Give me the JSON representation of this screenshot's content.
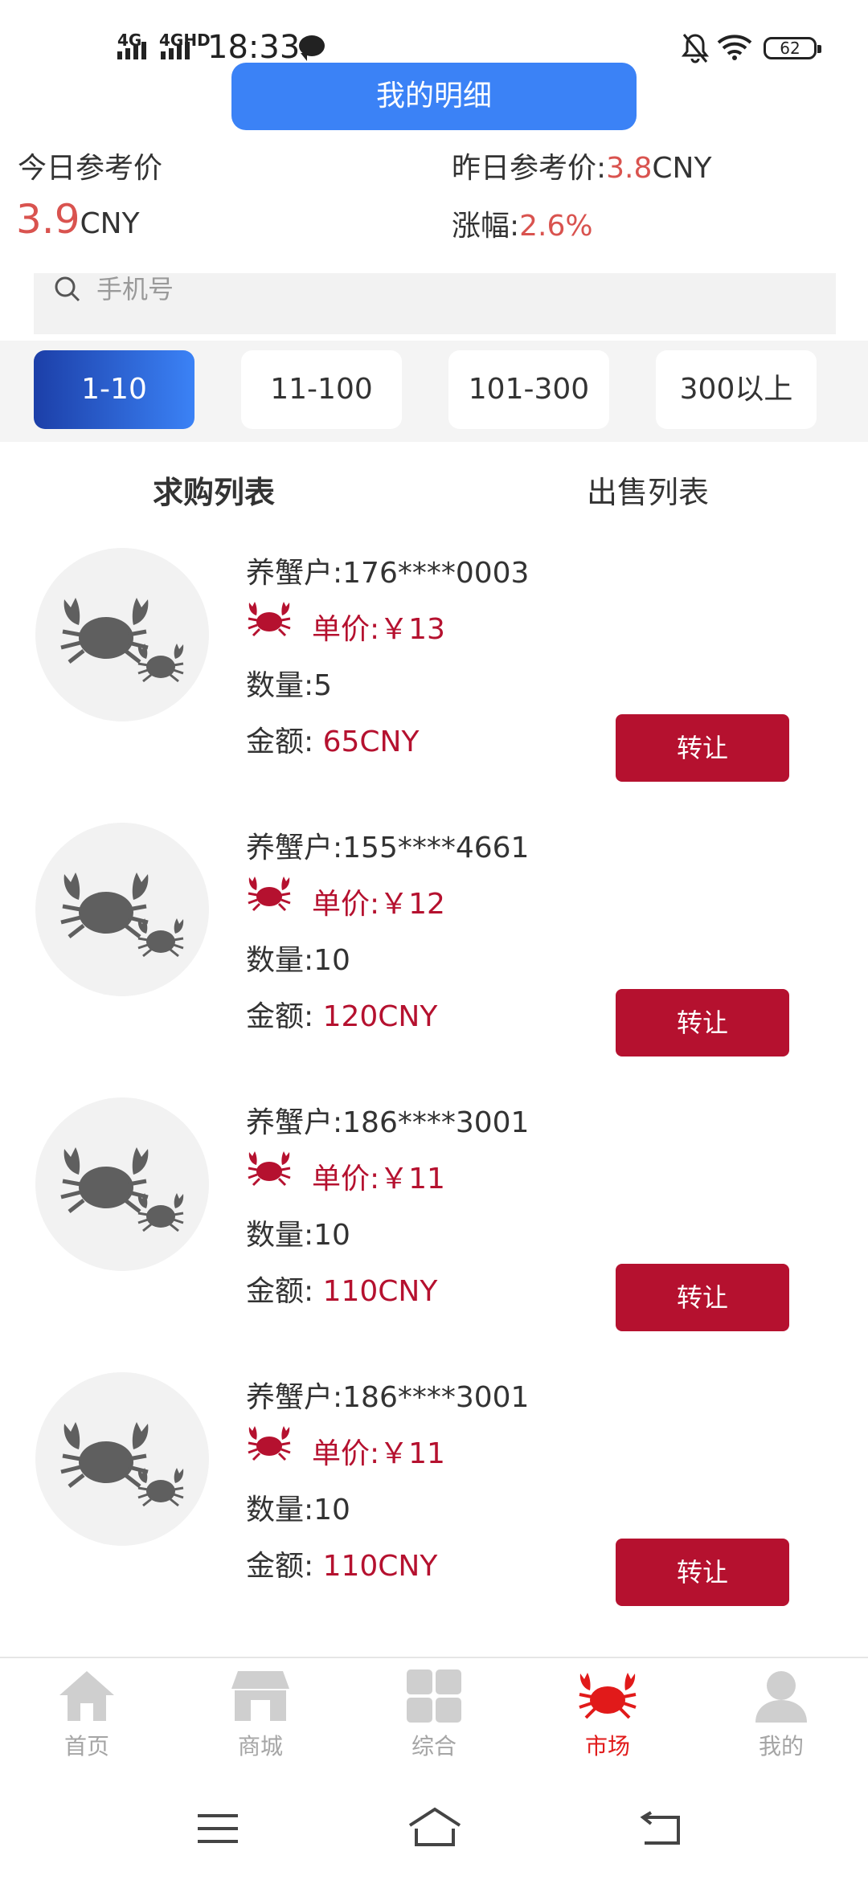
{
  "status_bar": {
    "network_1": "4G",
    "network_2": "4GHD",
    "time": "18:33",
    "battery": "62"
  },
  "header": {
    "detail_button": "我的明细"
  },
  "prices": {
    "today_label": "今日参考价",
    "today_value": "3.9",
    "today_unit": "CNY",
    "yesterday_label": "昨日参考价:",
    "yesterday_value": "3.8",
    "yesterday_unit": "CNY",
    "change_label": "涨幅:",
    "change_value": "2.6%"
  },
  "search": {
    "placeholder": "手机号"
  },
  "range_tabs": [
    "1-10",
    "11-100",
    "101-300",
    "300以上"
  ],
  "list_tabs": [
    "求购列表",
    "出售列表"
  ],
  "rows": [
    {
      "farmer": "养蟹户:176****0003",
      "price": "单价:￥13",
      "quantity": "数量:5",
      "amount_label": "金额: ",
      "amount_value": "65CNY",
      "button": "转让"
    },
    {
      "farmer": "养蟹户:155****4661",
      "price": "单价:￥12",
      "quantity": "数量:10",
      "amount_label": "金额: ",
      "amount_value": "120CNY",
      "button": "转让"
    },
    {
      "farmer": "养蟹户:186****3001",
      "price": "单价:￥11",
      "quantity": "数量:10",
      "amount_label": "金额: ",
      "amount_value": "110CNY",
      "button": "转让"
    },
    {
      "farmer": "养蟹户:186****3001",
      "price": "单价:￥11",
      "quantity": "数量:10",
      "amount_label": "金额: ",
      "amount_value": "110CNY",
      "button": "转让"
    }
  ],
  "bottom_nav": [
    {
      "label": "首页",
      "icon": "home-icon"
    },
    {
      "label": "商城",
      "icon": "store-icon"
    },
    {
      "label": "综合",
      "icon": "grid-icon"
    },
    {
      "label": "市场",
      "icon": "crab-icon"
    },
    {
      "label": "我的",
      "icon": "user-icon"
    }
  ],
  "colors": {
    "accent_blue": "#3b82f6",
    "crimson": "#b5112f",
    "price_red": "#d9534f",
    "active_nav": "#e11a1a"
  }
}
